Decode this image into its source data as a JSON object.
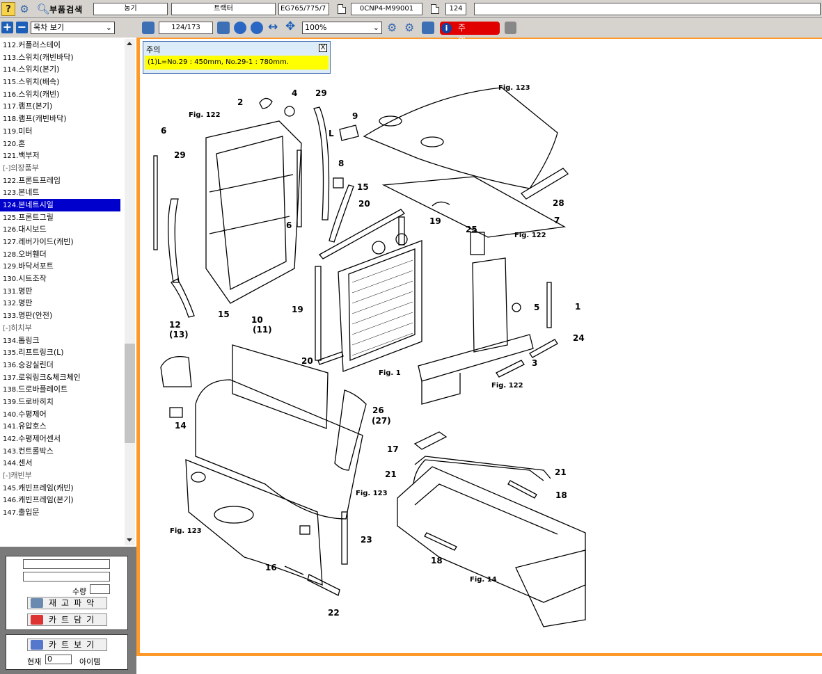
{
  "topbar": {
    "search_label": "부품검색",
    "field1": "농기",
    "field2": "트랙터",
    "field3": "EG765/775/7",
    "field4": "0CNP4-M99001",
    "field5": "124",
    "field6": ""
  },
  "left_toolbar": {
    "plus": "+",
    "minus": "−",
    "view_select": "목차 보기"
  },
  "tree": [
    {
      "num": "112.",
      "label": "커플러스테이"
    },
    {
      "num": "113.",
      "label": "스위치(캐빈바닥)"
    },
    {
      "num": "114.",
      "label": "스위치(본기)"
    },
    {
      "num": "115.",
      "label": "스위치(배속)"
    },
    {
      "num": "116.",
      "label": "스위치(캐빈)"
    },
    {
      "num": "117.",
      "label": "램프(본기)"
    },
    {
      "num": "118.",
      "label": "램프(캐빈바닥)"
    },
    {
      "num": "119.",
      "label": "미터"
    },
    {
      "num": "120.",
      "label": "혼"
    },
    {
      "num": "121.",
      "label": "백부저"
    },
    {
      "num": "[-]",
      "label": "의장품부",
      "cat": true
    },
    {
      "num": "122.",
      "label": "프론트프레임"
    },
    {
      "num": "123.",
      "label": "본네트"
    },
    {
      "num": "124.",
      "label": "본네트시일",
      "active": true
    },
    {
      "num": "125.",
      "label": "프론트그릴"
    },
    {
      "num": "126.",
      "label": "대시보드"
    },
    {
      "num": "127.",
      "label": "레버가이드(캐빈)"
    },
    {
      "num": "128.",
      "label": "오버휀더"
    },
    {
      "num": "129.",
      "label": "바닥서포트"
    },
    {
      "num": "130.",
      "label": "시트조작"
    },
    {
      "num": "131.",
      "label": "명판"
    },
    {
      "num": "132.",
      "label": "명판"
    },
    {
      "num": "133.",
      "label": "명판(안전)"
    },
    {
      "num": "[-]",
      "label": "히치부",
      "cat": true
    },
    {
      "num": "134.",
      "label": "톱링크"
    },
    {
      "num": "135.",
      "label": "리프트링크(L)"
    },
    {
      "num": "136.",
      "label": "승강실린더"
    },
    {
      "num": "137.",
      "label": "로워링크&체크체인"
    },
    {
      "num": "138.",
      "label": "드로바플레이트"
    },
    {
      "num": "139.",
      "label": "드로바히치"
    },
    {
      "num": "140.",
      "label": "수평제어"
    },
    {
      "num": "141.",
      "label": "유압호스"
    },
    {
      "num": "142.",
      "label": "수평제어센서"
    },
    {
      "num": "143.",
      "label": "컨트롤박스"
    },
    {
      "num": "144.",
      "label": "센서"
    },
    {
      "num": "[-]",
      "label": "캐빈부",
      "cat": true
    },
    {
      "num": "145.",
      "label": "캐빈프레임(캐빈)"
    },
    {
      "num": "146.",
      "label": "캐빈프레임(본기)"
    },
    {
      "num": "147.",
      "label": "출입문"
    }
  ],
  "order_panel": {
    "qty_label": "수량",
    "qty_value": "",
    "stock_button": "재고파악",
    "cart_add_button": "카트담기",
    "cart_view_button": "카트보기",
    "current_label": "현재",
    "current_value": "0",
    "items_label": "아이템"
  },
  "viewer_toolbar": {
    "page": "124/173",
    "zoom": "100%",
    "notice_button": "주 의"
  },
  "note": {
    "title": "주의",
    "close": "X",
    "body": "(1)L=No.29 : 450mm, No.29-1 : 780mm."
  },
  "diagram": {
    "part_numbers": [
      "1",
      "2",
      "3",
      "4",
      "5",
      "6",
      "6",
      "7",
      "8",
      "9",
      "10",
      "(11)",
      "12",
      "(13)",
      "14",
      "15",
      "15",
      "16",
      "17",
      "18",
      "18",
      "19",
      "19",
      "20",
      "20",
      "21",
      "21",
      "22",
      "23",
      "24",
      "25",
      "26",
      "(27)",
      "28",
      "29",
      "29"
    ],
    "fig_refs": [
      "Fig. 122",
      "Fig. 123",
      "Fig. 122",
      "Fig. 1",
      "Fig. 122",
      "Fig. 123",
      "Fig. 123",
      "Fig. 14"
    ],
    "arrow_label": "L"
  }
}
